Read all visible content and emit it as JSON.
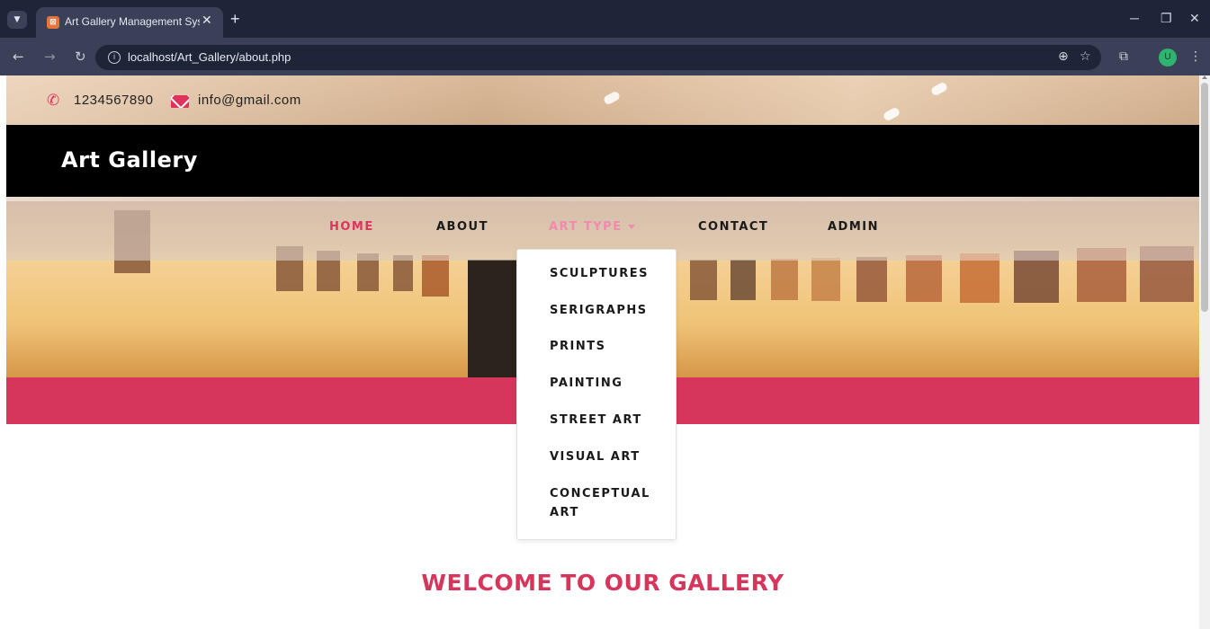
{
  "browser": {
    "tab_title": "Art Gallery Management System",
    "tab_favicon": "xampp-favicon-icon",
    "url": "localhost/Art_Gallery/about.php",
    "profile_initial": "U"
  },
  "topbar": {
    "phone": "1234567890",
    "email": "info@gmail.com"
  },
  "site": {
    "brand": "Art Gallery"
  },
  "nav": {
    "items": [
      {
        "label": "HOME",
        "state": "active"
      },
      {
        "label": "ABOUT",
        "state": "normal"
      },
      {
        "label": "ART TYPE",
        "state": "hover",
        "has_dropdown": true
      },
      {
        "label": "CONTACT",
        "state": "normal"
      },
      {
        "label": "ADMIN",
        "state": "normal"
      }
    ]
  },
  "dropdown": {
    "items": [
      {
        "label": "SCULPTURES"
      },
      {
        "label": "SERIGRAPHS"
      },
      {
        "label": "PRINTS"
      },
      {
        "label": "PAINTING"
      },
      {
        "label": "STREET ART"
      },
      {
        "label": "VISUAL ART"
      },
      {
        "label": "CONCEPTUAL ART"
      }
    ]
  },
  "main": {
    "heading": "WELCOME TO OUR GALLERY"
  },
  "colors": {
    "accent": "#d7365c",
    "nav_hover": "#f08aaf",
    "brandbar": "#000000"
  }
}
